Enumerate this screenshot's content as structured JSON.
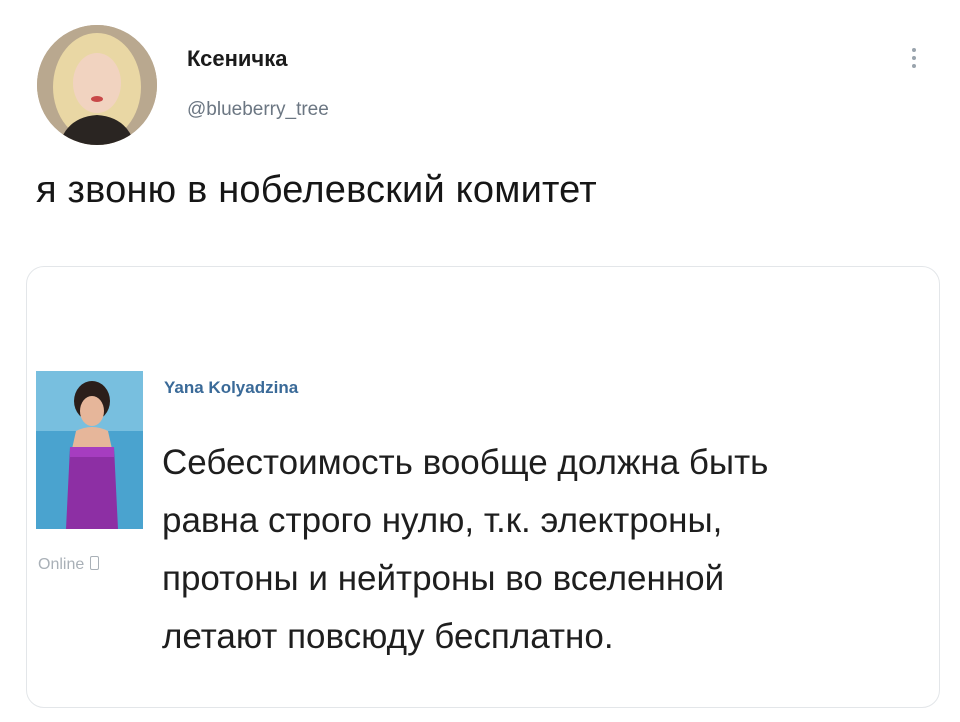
{
  "tweet": {
    "display_name": "Ксеничка",
    "handle": "@blueberry_tree",
    "text": "я звоню в нобелевский комитет",
    "avatar_icon": "profile-photo"
  },
  "quoted_post": {
    "author": "Yana Kolyadzina",
    "online_status": "Online",
    "status_icon": "mobile-phone-icon",
    "text_lines": [
      "Себестоимость вообще должна быть",
      "равна строго нулю, т.к. электроны,",
      "протоны и нейтроны во вселенной",
      "летают повсюду бесплатно."
    ],
    "link_color": "#3a6a98"
  }
}
